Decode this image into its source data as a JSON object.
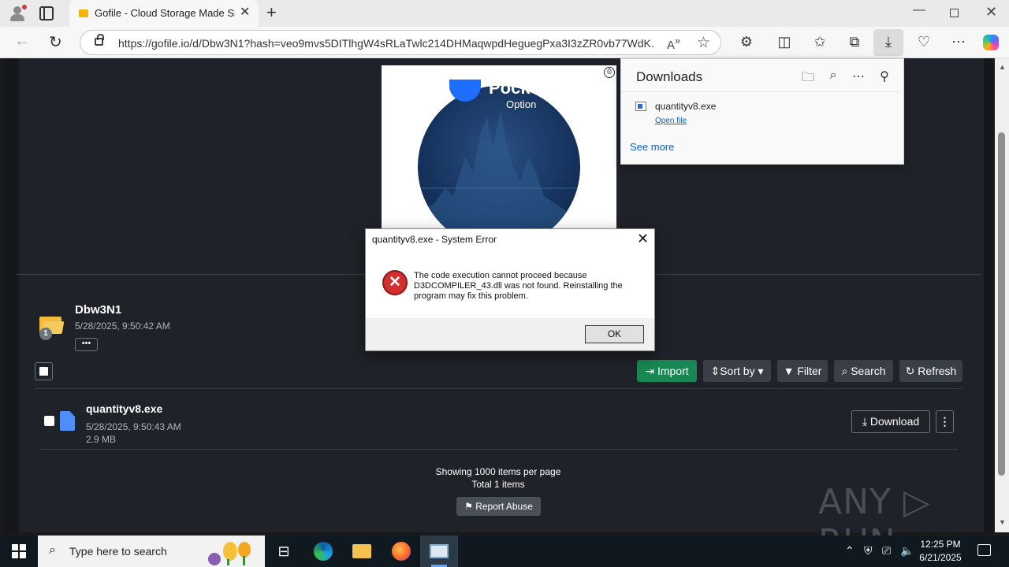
{
  "browser": {
    "tab_title": "Gofile - Cloud Storage Made Simple",
    "url": "https://gofile.io/d/Dbw3N1?hash=veo9mvs5DITlhgW4sRLaTwlc214DHMaqwpdHeguegPxa3I3zZR0vb77WdK...",
    "tab_close": "✕",
    "new_tab": "+"
  },
  "ad": {
    "brand": "Pock",
    "subtitle": "Option",
    "close_glyph": "⨶"
  },
  "folder": {
    "name": "Dbw3N1",
    "date": "5/28/2025, 9:50:42 AM",
    "count": "1",
    "more": "•••"
  },
  "toolbar": {
    "import": "Import",
    "sort": "Sort by",
    "filter": "Filter",
    "search": "Search",
    "refresh": "Refresh"
  },
  "file": {
    "name": "quantityv8.exe",
    "date": "5/28/2025, 9:50:43 AM",
    "size": "2.9 MB",
    "download": "Download"
  },
  "pagination": {
    "showing": "Showing 1000 items per page",
    "total": "Total 1 items",
    "report": "Report Abuse"
  },
  "watermark": "ANY ▷ RUN",
  "downloads_panel": {
    "title": "Downloads",
    "file_name": "quantityv8.exe",
    "open_file": "Open file",
    "see_more": "See more"
  },
  "error_dialog": {
    "title": "quantityv8.exe - System Error",
    "message": "The code execution cannot proceed because D3DCOMPILER_43.dll was not found. Reinstalling the program may fix this problem.",
    "ok": "OK"
  },
  "taskbar": {
    "search_placeholder": "Type here to search",
    "time": "12:25 PM",
    "date": "6/21/2025"
  }
}
